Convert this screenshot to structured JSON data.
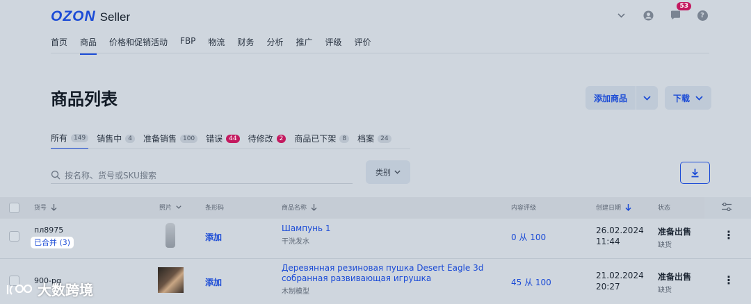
{
  "header": {
    "brand": "OZON",
    "product": "Seller",
    "notifications_count": "53"
  },
  "nav": {
    "items": [
      "首页",
      "商品",
      "价格和促销活动",
      "FBP",
      "物流",
      "财务",
      "分析",
      "推广",
      "评级",
      "评价"
    ],
    "active_index": 1
  },
  "page": {
    "title": "商品列表",
    "add_button": "添加商品",
    "download_button": "下载"
  },
  "tabs": [
    {
      "label": "所有",
      "count": "149"
    },
    {
      "label": "销售中",
      "count": "4"
    },
    {
      "label": "准备销售",
      "count": "100"
    },
    {
      "label": "错误",
      "count": "44"
    },
    {
      "label": "待修改",
      "count": "2"
    },
    {
      "label": "商品已下架",
      "count": "8"
    },
    {
      "label": "档案",
      "count": "24"
    }
  ],
  "search": {
    "placeholder": "按名称、货号或SKU搜索"
  },
  "filter": {
    "category_label": "类别"
  },
  "table": {
    "headers": {
      "sku": "货号",
      "photo": "照片",
      "barcode": "条形码",
      "name": "商品名称",
      "content_rating": "内容评级",
      "created": "创建日期",
      "status": "状态"
    },
    "rows": [
      {
        "sku": "пл8975",
        "merged": "已合并 (3)",
        "barcode": "添加",
        "name": "Шампунь 1",
        "category": "干洗发水",
        "rating": "0 从 100",
        "date": "26.02.2024",
        "time": "11:44",
        "status": "准备出售",
        "substatus": "缺货"
      },
      {
        "sku": "900-pg",
        "barcode": "添加",
        "name_line1": "Деревянная резиновая пушка Desert Eagle 3d",
        "name_line2": "собранная развивающая игрушка",
        "category": "木制模型",
        "rating": "45 从 100",
        "date": "21.02.2024",
        "time": "20:27",
        "status": "准备出售",
        "substatus": "缺货"
      }
    ]
  },
  "watermark": {
    "text": "大数跨境"
  },
  "colors": {
    "accent": "#1b4bd6",
    "badge": "#c3195f"
  }
}
